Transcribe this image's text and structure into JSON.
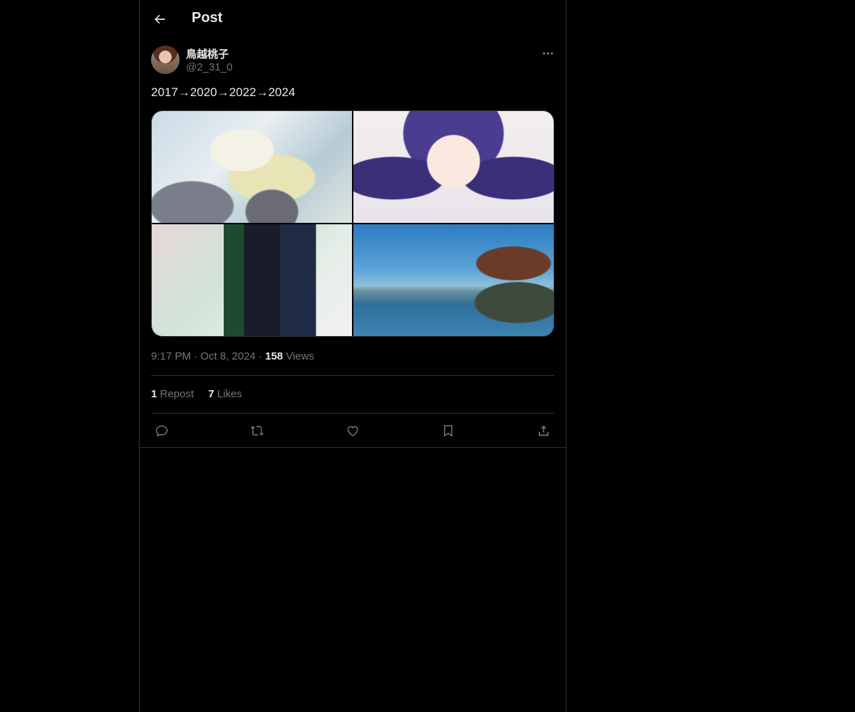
{
  "header": {
    "title": "Post"
  },
  "author": {
    "name": "鳥越桃子",
    "handle": "@2_31_0"
  },
  "post": {
    "text": "2017→2020→2022→2024",
    "time": "9:17 PM",
    "date": "Oct 8, 2024",
    "views_count": "158",
    "views_label": "Views",
    "reposts_count": "1",
    "reposts_label": "Repost",
    "likes_count": "7",
    "likes_label": "Likes",
    "media": [
      {
        "icon": "watercolor-illustration-image"
      },
      {
        "icon": "anime-girl-drawing-image"
      },
      {
        "icon": "green-jacket-illustration-image"
      },
      {
        "icon": "horse-girl-seaside-image"
      }
    ]
  },
  "actions": [
    "reply-icon",
    "repost-icon",
    "like-icon",
    "bookmark-icon",
    "share-icon"
  ],
  "colors": {
    "background": "#000000",
    "text": "#e7e9ea",
    "muted": "#71767b",
    "border": "#2f3336"
  }
}
